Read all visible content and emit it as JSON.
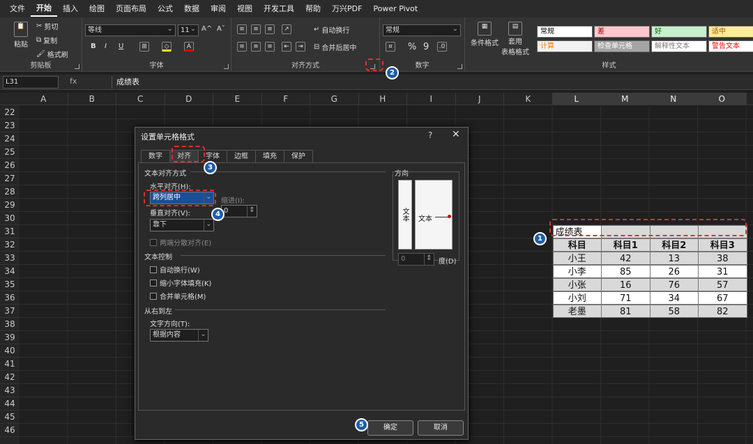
{
  "menu": {
    "tabs": [
      "文件",
      "开始",
      "插入",
      "绘图",
      "页面布局",
      "公式",
      "数据",
      "审阅",
      "视图",
      "开发工具",
      "帮助",
      "万兴PDF",
      "Power Pivot"
    ],
    "active": "开始"
  },
  "ribbon": {
    "clipboard": {
      "label": "剪贴板",
      "paste": "粘贴",
      "cut": "剪切",
      "copy": "复制",
      "painter": "格式刷"
    },
    "font": {
      "label": "字体",
      "name": "等线",
      "size": "11",
      "bold": "B",
      "italic": "I",
      "underline": "U",
      "grow": "A^",
      "shrink": "Aˇ"
    },
    "align": {
      "label": "对齐方式",
      "wrap": "自动换行",
      "merge": "合并后居中"
    },
    "number": {
      "label": "数字",
      "format": "常规",
      "percent": "%",
      "comma": "9"
    },
    "styles": {
      "label": "样式",
      "cond": "条件格式",
      "table_a": "套用",
      "table_b": "表格格式",
      "cells": [
        {
          "text": "常规",
          "bg": "#ffffff",
          "fg": "#000000"
        },
        {
          "text": "差",
          "bg": "#ffc7ce",
          "fg": "#9c0006"
        },
        {
          "text": "好",
          "bg": "#c6efce",
          "fg": "#006100"
        },
        {
          "text": "适中",
          "bg": "#ffeb9c",
          "fg": "#9c5700"
        },
        {
          "text": "计算",
          "bg": "#f2f2f2",
          "fg": "#fa7d00"
        },
        {
          "text": "检查单元格",
          "bg": "#a5a5a5",
          "fg": "#ffffff"
        },
        {
          "text": "解释性文本",
          "bg": "#ffffff",
          "fg": "#7f7f7f"
        },
        {
          "text": "警告文本",
          "bg": "#ffffff",
          "fg": "#ff0000"
        }
      ]
    }
  },
  "formula_bar": {
    "cell": "L31",
    "fx": "fx",
    "content": "成绩表"
  },
  "columns": [
    "A",
    "B",
    "C",
    "D",
    "E",
    "F",
    "G",
    "H",
    "I",
    "J",
    "K",
    "L",
    "M",
    "N",
    "O"
  ],
  "rows": [
    "22",
    "23",
    "24",
    "25",
    "26",
    "27",
    "28",
    "29",
    "30",
    "31",
    "32",
    "33",
    "34",
    "35",
    "36",
    "37",
    "38",
    "39",
    "40",
    "41",
    "42",
    "43",
    "44",
    "45",
    "46"
  ],
  "table": {
    "title": "成绩表",
    "headers": [
      "科目",
      "科目1",
      "科目2",
      "科目3"
    ],
    "data": [
      [
        "小王",
        "42",
        "13",
        "38"
      ],
      [
        "小李",
        "85",
        "26",
        "31"
      ],
      [
        "小张",
        "16",
        "76",
        "57"
      ],
      [
        "小刘",
        "71",
        "34",
        "67"
      ],
      [
        "老墨",
        "81",
        "58",
        "82"
      ]
    ]
  },
  "dialog": {
    "title": "设置单元格格式",
    "help": "?",
    "close": "✕",
    "tabs": [
      "数字",
      "对齐",
      "字体",
      "边框",
      "填充",
      "保护"
    ],
    "active_tab": "对齐",
    "text_align_section": "文本对齐方式",
    "horizontal_label": "水平对齐(H):",
    "horizontal_value": "跨列居中",
    "indent_label": "缩进(I):",
    "indent_value": "0",
    "vertical_label": "垂直对齐(V):",
    "vertical_value": "靠下",
    "distributed": "两端分散对齐(E)",
    "text_control": "文本控制",
    "wrap": "自动换行(W)",
    "shrink": "缩小字体填充(K)",
    "merge": "合并单元格(M)",
    "rtl_section": "从右到左",
    "direction_label": "文字方向(T):",
    "direction_value": "根据内容",
    "orientation": "方向",
    "orient_vertical": "文本",
    "orient_text": "文本",
    "degree_value": "0",
    "degree_label": "度(D)",
    "ok": "确定",
    "cancel": "取消"
  },
  "badges": [
    "1",
    "2",
    "3",
    "4",
    "5"
  ]
}
